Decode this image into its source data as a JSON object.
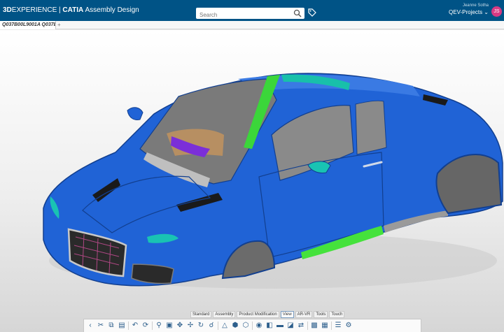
{
  "header": {
    "brand_bold": "3D",
    "brand_mid": "EXPERIENCE",
    "brand_sep": " | ",
    "brand_app": "CATIA",
    "brand_role": " Assembly Design",
    "search_placeholder": "Search",
    "user_name": "Jeanne Sotha",
    "project": "QEV-Projects ⌄",
    "avatar_initials": "JS"
  },
  "tabs": [
    {
      "label": "Q037B00L9001A Q037B00"
    }
  ],
  "tab_add": "+",
  "sections": [
    "Standard",
    "Assembly",
    "Product Modification",
    "View",
    "AR-VR",
    "Tools",
    "Touch"
  ],
  "active_section": "View",
  "toolbar": {
    "icons": [
      "collapse-icon",
      "cut-icon",
      "copy-icon",
      "paste-icon",
      "undo-icon",
      "update-icon",
      "zoom-icon",
      "cube-icon",
      "fit-all-icon",
      "pan-icon",
      "rotate-icon",
      "zoom-area-icon",
      "normal-view-icon",
      "iso-view-icon",
      "view-mode-icon",
      "render-icon",
      "shading-icon",
      "ground-icon",
      "section-icon",
      "measure-icon",
      "capture-icon",
      "tree-icon",
      "layout-icon"
    ]
  },
  "colors": {
    "header_bg": "#005386",
    "car_body": "#1f5fd4",
    "highlight_green": "#3bd63a",
    "accent_cyan": "#17c3b0",
    "interior_purple": "#7b2fd8"
  }
}
